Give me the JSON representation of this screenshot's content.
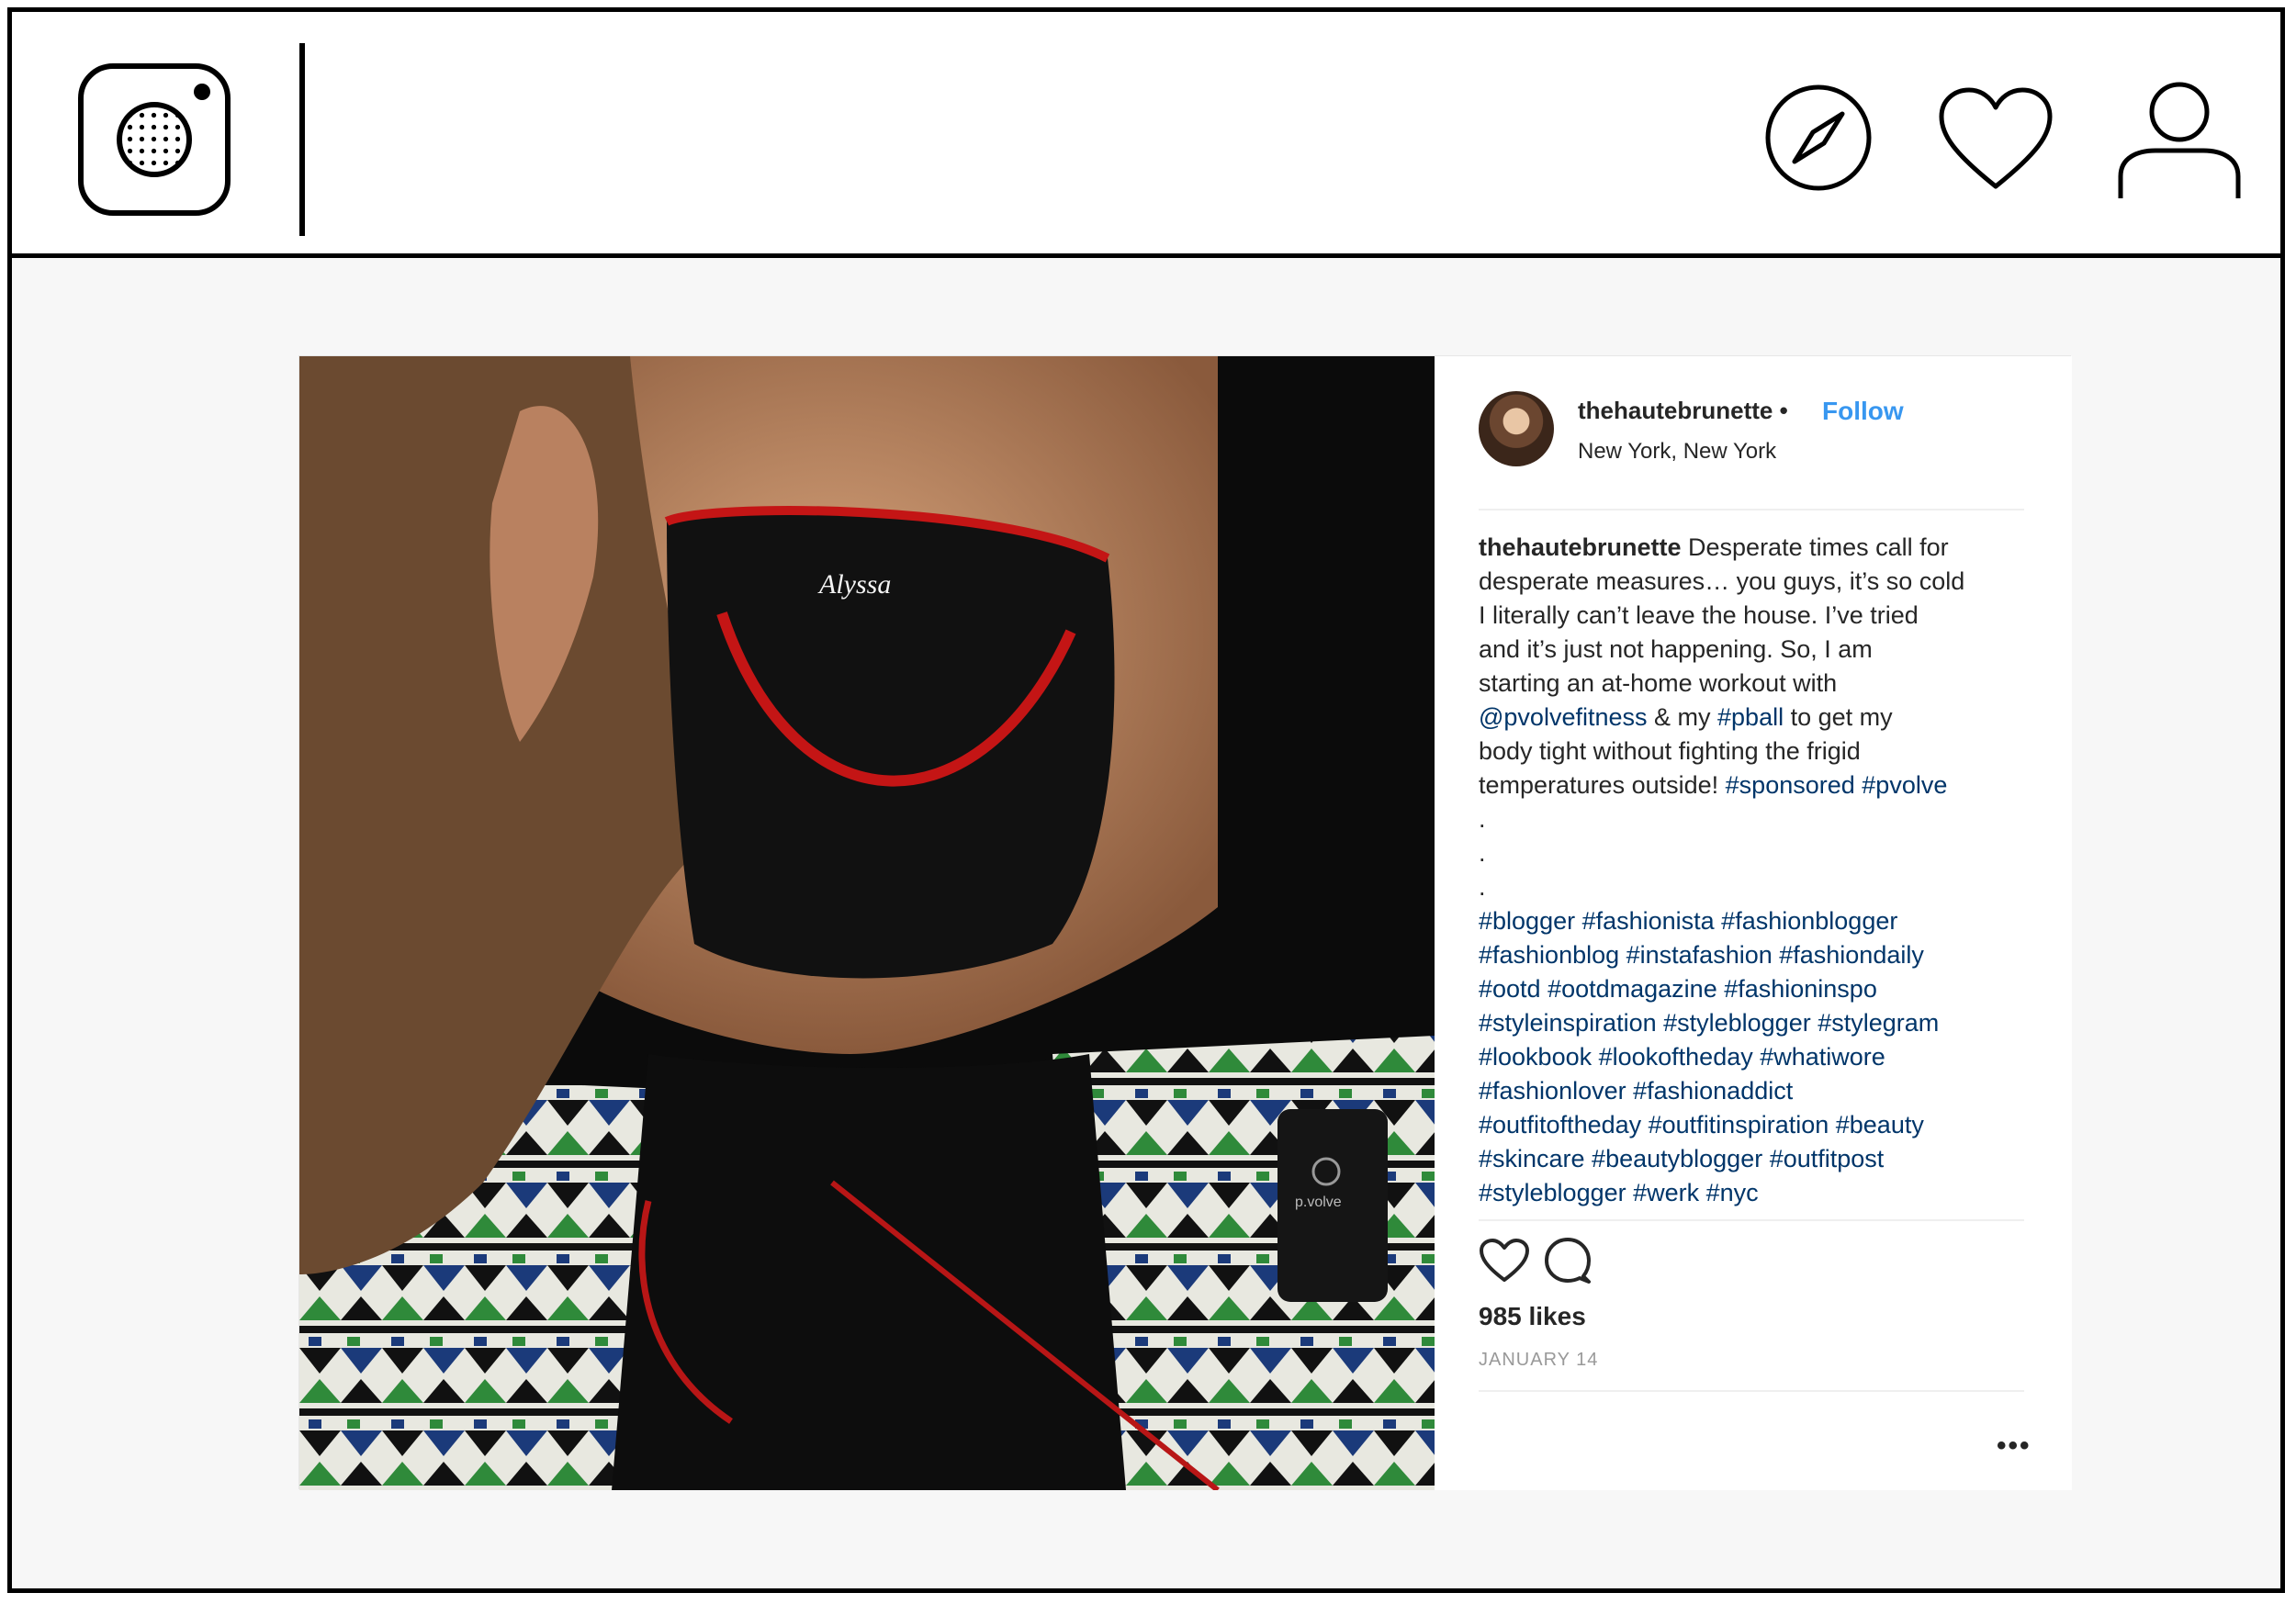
{
  "nav": {
    "logo_icon": "camera-icon",
    "explore_icon": "compass-icon",
    "activity_icon": "heart-icon",
    "profile_icon": "user-icon"
  },
  "post": {
    "username": "thehautebrunette",
    "separator": "•",
    "follow_label": "Follow",
    "location": "New York, New York",
    "caption": {
      "user": "thehautebrunette",
      "lines": [
        [
          {
            "t": " Desperate times call for"
          }
        ],
        [
          {
            "t": "desperate measures… you guys, it’s so cold"
          }
        ],
        [
          {
            "t": "I literally can’t leave the house. I’ve tried"
          }
        ],
        [
          {
            "t": "and it’s just not happening. So, I am"
          }
        ],
        [
          {
            "t": "starting an at-home workout with"
          }
        ],
        [
          {
            "t": "@pvolvefitness",
            "tag": true
          },
          {
            "t": " & my "
          },
          {
            "t": "#pball",
            "tag": true
          },
          {
            "t": " to get my"
          }
        ],
        [
          {
            "t": "body tight without fighting the frigid"
          }
        ],
        [
          {
            "t": "temperatures outside! "
          },
          {
            "t": "#sponsored",
            "tag": true
          },
          {
            "t": " "
          },
          {
            "t": "#pvolve",
            "tag": true
          }
        ],
        [
          {
            "t": "."
          }
        ],
        [
          {
            "t": "."
          }
        ],
        [
          {
            "t": "."
          }
        ],
        [
          {
            "t": "#blogger #fashionista #fashionblogger",
            "tag": true
          }
        ],
        [
          {
            "t": "#fashionblog #instafashion #fashiondaily",
            "tag": true
          }
        ],
        [
          {
            "t": "#ootd #ootdmagazine #fashioninspo",
            "tag": true
          }
        ],
        [
          {
            "t": "#styleinspiration #styleblogger #stylegram",
            "tag": true
          }
        ],
        [
          {
            "t": "#lookbook #lookoftheday #whatiwore",
            "tag": true
          }
        ],
        [
          {
            "t": "#fashionlover #fashionaddict",
            "tag": true
          }
        ],
        [
          {
            "t": "#outfitoftheday #outfitinspiration #beauty",
            "tag": true
          }
        ],
        [
          {
            "t": "#skincare #beautyblogger #outfitpost",
            "tag": true
          }
        ],
        [
          {
            "t": "#styleblogger #werk #nyc",
            "tag": true
          }
        ]
      ]
    },
    "likes": "985 likes",
    "date": "JANUARY 14",
    "more_label": "•••",
    "photo_brand": "p.volve",
    "colors": {
      "link_blue": "#3897f0",
      "hashtag": "#003569",
      "text": "#262626"
    }
  }
}
